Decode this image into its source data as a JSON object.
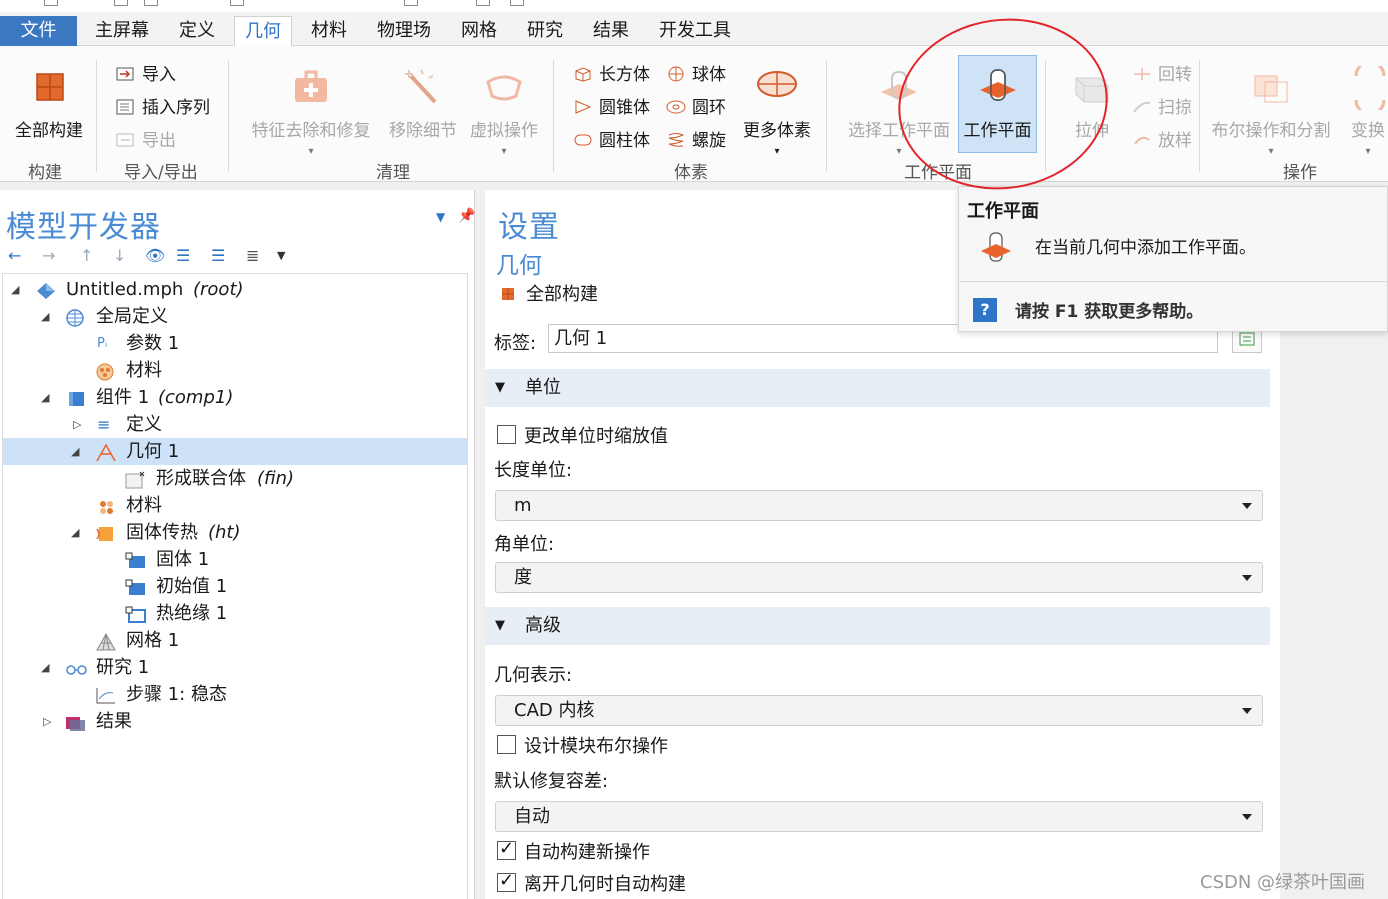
{
  "menu": {
    "file": "文件",
    "tabs": [
      "主屏幕",
      "定义",
      "几何",
      "材料",
      "物理场",
      "网格",
      "研究",
      "结果",
      "开发工具"
    ],
    "active_tab": "几何"
  },
  "ribbon": {
    "build": {
      "button": "全部构建",
      "group": "构建"
    },
    "import_export": {
      "import": "导入",
      "insert_sequence": "插入序列",
      "export": "导出",
      "group": "导入/导出"
    },
    "cleanup": {
      "defeature": "特征去除和修复",
      "remove_details": "移除细节",
      "virtual_ops": "虚拟操作",
      "group": "清理"
    },
    "primitives": {
      "block": "长方体",
      "sphere": "球体",
      "cone": "圆锥体",
      "torus": "圆环",
      "cylinder": "圆柱体",
      "helix": "螺旋",
      "more": "更多体素",
      "group": "体素"
    },
    "workplane": {
      "select": "选择工作平面",
      "add": "工作平面",
      "group": "工作平面"
    },
    "operations": {
      "extrude": "拉伸",
      "revolve": "回转",
      "sweep": "扫掠",
      "loft": "放样",
      "booleans": "布尔操作和分割",
      "transforms": "变换",
      "group": "操作"
    }
  },
  "model_builder": {
    "title": "模型开发器",
    "tree": [
      {
        "label": "Untitled.mph",
        "suffix": "(root)"
      },
      {
        "label": "全局定义",
        "suffix": ""
      },
      {
        "label": "参数 1",
        "suffix": ""
      },
      {
        "label": "材料",
        "suffix": ""
      },
      {
        "label": "组件 1",
        "suffix": "(comp1)"
      },
      {
        "label": "定义",
        "suffix": ""
      },
      {
        "label": "几何 1",
        "suffix": ""
      },
      {
        "label": "形成联合体",
        "suffix": "(fin)"
      },
      {
        "label": "材料",
        "suffix": ""
      },
      {
        "label": "固体传热",
        "suffix": "(ht)"
      },
      {
        "label": "固体 1",
        "suffix": ""
      },
      {
        "label": "初始值 1",
        "suffix": ""
      },
      {
        "label": "热绝缘 1",
        "suffix": ""
      },
      {
        "label": "网格 1",
        "suffix": ""
      },
      {
        "label": "研究 1",
        "suffix": ""
      },
      {
        "label": "步骤 1: 稳态",
        "suffix": ""
      },
      {
        "label": "结果",
        "suffix": ""
      }
    ]
  },
  "settings": {
    "title": "设置",
    "subtitle": "几何",
    "build_all": "全部构建",
    "label_caption": "标签:",
    "label_value": "几何 1",
    "units_section": "单位",
    "scale_on_unit_change": "更改单位时缩放值",
    "length_unit_label": "长度单位:",
    "length_unit": "m",
    "angle_unit_label": "角单位:",
    "angle_unit": "度",
    "advanced_section": "高级",
    "geometry_repr_label": "几何表示:",
    "geometry_repr": "CAD 内核",
    "design_module_boolean": "设计模块布尔操作",
    "repair_tolerance_label": "默认修复容差:",
    "repair_tolerance": "自动",
    "auto_build_new": "自动构建新操作",
    "auto_build_leave": "离开几何时自动构建"
  },
  "checkbox_states": {
    "scale": false,
    "design_module": false,
    "auto_build_new": true,
    "auto_build_leave": true
  },
  "tooltip": {
    "title": "工作平面",
    "description": "在当前几何中添加工作平面。",
    "help": "请按 F1 获取更多帮助。"
  },
  "watermark": "CSDN @绿茶叶国画",
  "colors": {
    "accent": "#2f75c7",
    "selection": "#cde2f7",
    "annotation": "#e2252b"
  }
}
